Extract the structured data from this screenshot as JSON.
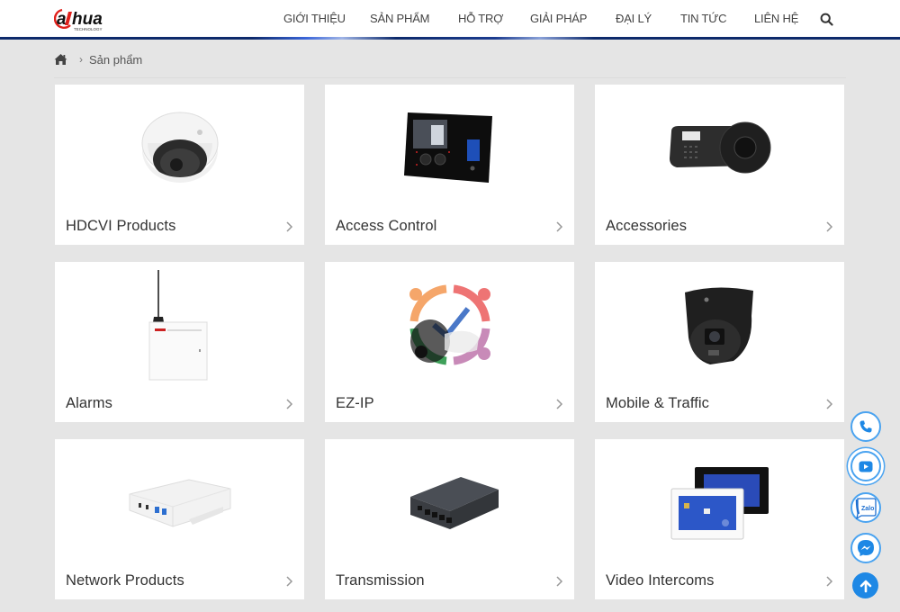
{
  "header": {
    "logo_text": "alhua",
    "logo_sub": "TECHNOLOGY",
    "brand_color": "#e0201b",
    "nav": [
      {
        "label": "GIỚI THIỆU"
      },
      {
        "label": "SẢN PHẨM"
      },
      {
        "label": "HỖ TRỢ"
      },
      {
        "label": "GIẢI PHÁP"
      },
      {
        "label": "ĐẠI LÝ"
      },
      {
        "label": "TIN TỨC"
      },
      {
        "label": "LIÊN HỆ"
      }
    ],
    "search_icon": "search-icon"
  },
  "breadcrumb": {
    "home_icon": "home-icon",
    "separator": "›",
    "current": "Sản phẩm"
  },
  "products": [
    {
      "title": "HDCVI Products",
      "image": "dome-camera"
    },
    {
      "title": "Access Control",
      "image": "access-terminal"
    },
    {
      "title": "Accessories",
      "image": "ptz-keyboard"
    },
    {
      "title": "Alarms",
      "image": "alarm-panel"
    },
    {
      "title": "EZ-IP",
      "image": "ezip-logo"
    },
    {
      "title": "Mobile & Traffic",
      "image": "turret-camera"
    },
    {
      "title": "Network Products",
      "image": "mini-nvr"
    },
    {
      "title": "Transmission",
      "image": "poe-switch"
    },
    {
      "title": "Video Intercoms",
      "image": "indoor-monitors"
    }
  ],
  "floating": {
    "phone": "phone-icon",
    "youtube": "youtube-icon",
    "zalo_label": "Zalo",
    "messenger": "messenger-icon",
    "back_to_top": "arrow-up-icon",
    "accent": "#1e88e5"
  }
}
